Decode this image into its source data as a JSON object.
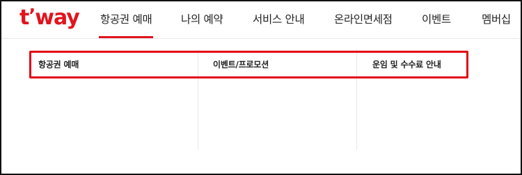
{
  "brand": {
    "logo_t": "t",
    "logo_quote": "’",
    "logo_way": "way",
    "accent_color": "#e1141e"
  },
  "nav": {
    "items": [
      {
        "label": "항공권 예매",
        "active": true
      },
      {
        "label": "나의 예약",
        "active": false
      },
      {
        "label": "서비스 안내",
        "active": false
      },
      {
        "label": "온라인면세점",
        "active": false
      },
      {
        "label": "이벤트",
        "active": false
      },
      {
        "label": "멤버십",
        "active": false
      }
    ]
  },
  "submenu": {
    "columns": [
      {
        "title": "항공권 예매"
      },
      {
        "title": "이벤트/프로모션"
      },
      {
        "title": "운임 및 수수료 안내"
      }
    ],
    "highlight_color": "#e30613"
  }
}
